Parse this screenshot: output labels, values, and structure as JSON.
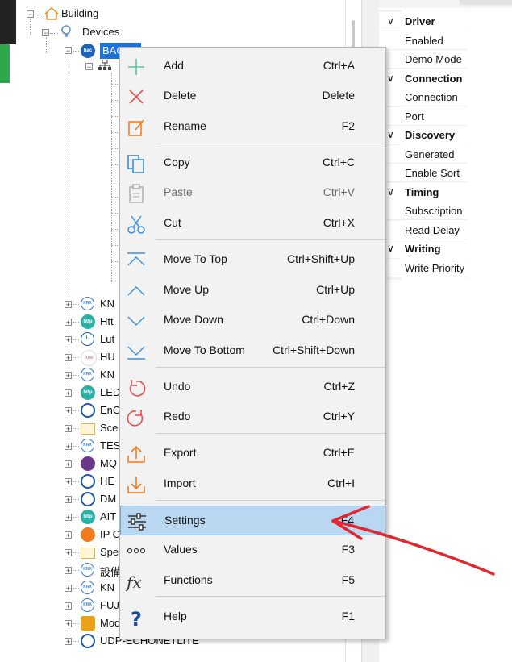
{
  "tree": {
    "root_label": "Building",
    "devices_label": "Devices",
    "selected_label": "BACnet",
    "nodes": [
      {
        "label": "KN",
        "icon": "knx-icon"
      },
      {
        "label": "Htt",
        "icon": "http-icon"
      },
      {
        "label": "Lut",
        "icon": "lutron-icon"
      },
      {
        "label": "HU",
        "icon": "hue-icon"
      },
      {
        "label": "KN",
        "icon": "knx-icon"
      },
      {
        "label": "LED",
        "icon": "http-icon"
      },
      {
        "label": "EnO",
        "icon": "cloud-icon"
      },
      {
        "label": "Sce",
        "icon": "folder-icon"
      },
      {
        "label": "TES",
        "icon": "knx-icon"
      },
      {
        "label": "MQ",
        "icon": "mqtt-icon"
      },
      {
        "label": "HE",
        "icon": "cloud-icon"
      },
      {
        "label": "DM",
        "icon": "cloud-icon"
      },
      {
        "label": "AIT",
        "icon": "http-icon"
      },
      {
        "label": "IP C",
        "icon": "ip-camera-icon"
      },
      {
        "label": "Spe",
        "icon": "folder-icon"
      },
      {
        "label": "設備",
        "icon": "knx-icon"
      },
      {
        "label": "KN",
        "icon": "knx-icon"
      },
      {
        "label": "FUJ",
        "icon": "knx-icon"
      },
      {
        "label": "Modbus",
        "icon": "modbus-icon"
      },
      {
        "label": "UDP-ECHONETLITE",
        "icon": "cloud-icon"
      }
    ]
  },
  "properties": {
    "categories": [
      {
        "label": "Driver",
        "items": [
          "Enabled",
          "Demo Mode"
        ]
      },
      {
        "label": "Connection",
        "items": [
          "Connection",
          "Port"
        ]
      },
      {
        "label": "Discovery",
        "items": [
          "Generated",
          "Enable Sort"
        ]
      },
      {
        "label": "Timing",
        "items": [
          "Subscription",
          "Read Delay"
        ]
      },
      {
        "label": "Writing",
        "items": [
          "Write Priority"
        ]
      }
    ]
  },
  "context_menu": {
    "items": [
      {
        "label": "Add",
        "shortcut": "Ctrl+A",
        "icon": "plus-icon",
        "disabled": false
      },
      {
        "label": "Delete",
        "shortcut": "Delete",
        "icon": "x-icon",
        "disabled": false
      },
      {
        "label": "Rename",
        "shortcut": "F2",
        "icon": "rename-icon",
        "disabled": false
      },
      {
        "label": "Copy",
        "shortcut": "Ctrl+C",
        "icon": "copy-icon",
        "disabled": false
      },
      {
        "label": "Paste",
        "shortcut": "Ctrl+V",
        "icon": "paste-icon",
        "disabled": true
      },
      {
        "label": "Cut",
        "shortcut": "Ctrl+X",
        "icon": "scissors-icon",
        "disabled": false
      },
      {
        "label": "Move To Top",
        "shortcut": "Ctrl+Shift+Up",
        "icon": "move-top-icon",
        "disabled": false
      },
      {
        "label": "Move Up",
        "shortcut": "Ctrl+Up",
        "icon": "move-up-icon",
        "disabled": false
      },
      {
        "label": "Move Down",
        "shortcut": "Ctrl+Down",
        "icon": "move-down-icon",
        "disabled": false
      },
      {
        "label": "Move To Bottom",
        "shortcut": "Ctrl+Shift+Down",
        "icon": "move-bottom-icon",
        "disabled": false
      },
      {
        "label": "Undo",
        "shortcut": "Ctrl+Z",
        "icon": "undo-icon",
        "disabled": false
      },
      {
        "label": "Redo",
        "shortcut": "Ctrl+Y",
        "icon": "redo-icon",
        "disabled": false
      },
      {
        "label": "Export",
        "shortcut": "Ctrl+E",
        "icon": "export-icon",
        "disabled": false
      },
      {
        "label": "Import",
        "shortcut": "Ctrl+I",
        "icon": "import-icon",
        "disabled": false
      },
      {
        "label": "Settings",
        "shortcut": "F4",
        "icon": "settings-sliders-icon",
        "disabled": false,
        "highlighted": true
      },
      {
        "label": "Values",
        "shortcut": "F3",
        "icon": "values-dots-icon",
        "disabled": false
      },
      {
        "label": "Functions",
        "shortcut": "F5",
        "icon": "fx-icon",
        "disabled": false
      },
      {
        "label": "Help",
        "shortcut": "F1",
        "icon": "help-icon",
        "disabled": false
      }
    ]
  },
  "colors": {
    "accent_red": "#e1262d",
    "selection_blue": "#1d73d8",
    "menu_highlight": "#bad7f2",
    "icon_blue": "#3a8fd8",
    "icon_orange": "#f07b1e"
  }
}
